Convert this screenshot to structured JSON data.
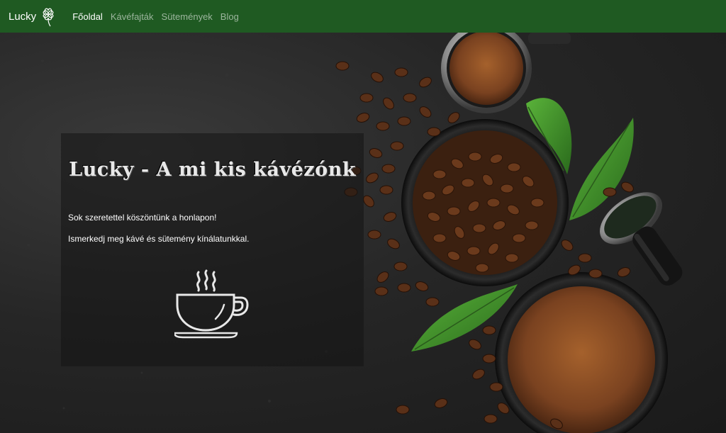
{
  "navbar": {
    "brand": "Lucky",
    "brand_icon": "clover-icon",
    "links": [
      {
        "label": "Főoldal",
        "active": true
      },
      {
        "label": "Kávéfajták",
        "active": false
      },
      {
        "label": "Sütemények",
        "active": false
      },
      {
        "label": "Blog",
        "active": false
      }
    ]
  },
  "hero": {
    "title": "Lucky - A mi kis kávézónk",
    "welcome": "Sok szeretettel köszöntünk a honlapon!",
    "intro": "Ismerkedj meg kávé és sütemény kínálatunkkal.",
    "illustration_icon": "coffee-cup-icon"
  },
  "colors": {
    "navbar_bg": "#1f5a22",
    "background": "#1e1e1e",
    "coffee_bean": "#6b3a1c",
    "leaf": "#3f8f2a"
  }
}
